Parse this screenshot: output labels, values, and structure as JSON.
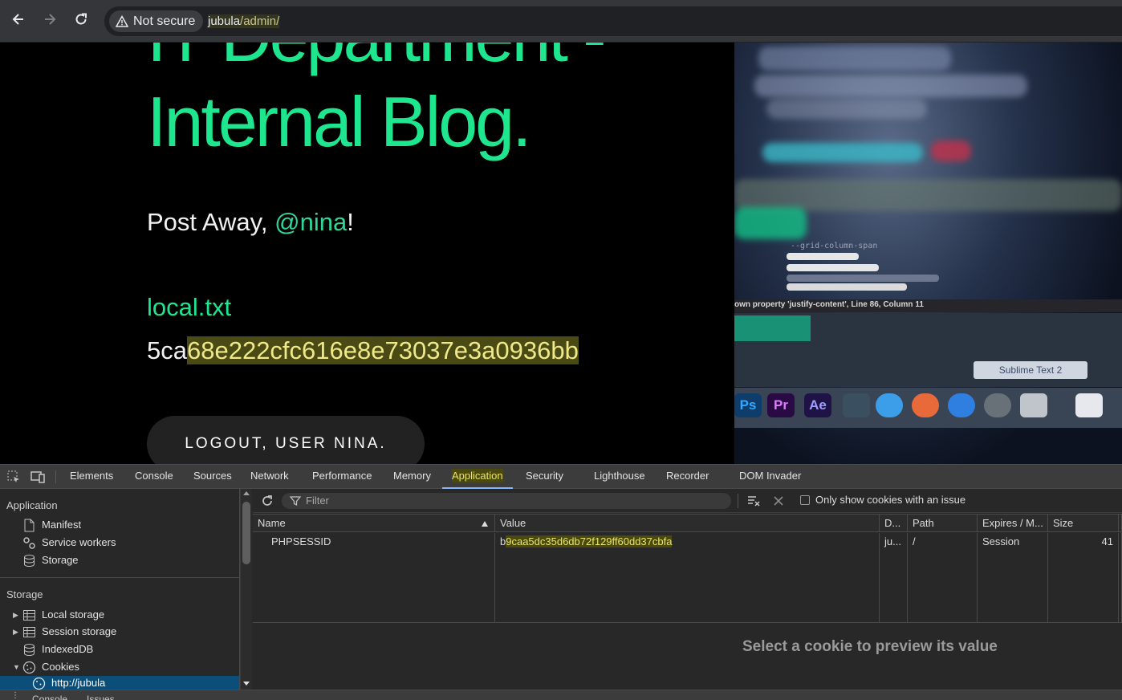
{
  "browser": {
    "security_label": "Not secure",
    "url_host": "jubula",
    "url_path": "/admin/"
  },
  "page": {
    "title_line1": "IT Department -",
    "title_line2": "Internal Blog.",
    "greeting_prefix": "Post Away, ",
    "greeting_user": "@nina",
    "greeting_suffix": "!",
    "file_link": "local.txt",
    "hash_prefix": "5ca",
    "hash_highlight": "68e222cfc616e8e73037e3a0936bb",
    "logout_label": "LOGOUT, USER NINA.",
    "image_text_top": "--grid-column-span",
    "image_caption": "own property 'justify-content', Line 86, Column 11",
    "image_tooltip": "Sublime Text 2",
    "dock_labels": [
      "Ps",
      "Pr",
      "Ae"
    ]
  },
  "devtools": {
    "tabs": [
      "Elements",
      "Console",
      "Sources",
      "Network",
      "Performance",
      "Memory",
      "Application",
      "Security",
      "Lighthouse",
      "Recorder",
      "DOM Invader"
    ],
    "active_tab": "Application",
    "sidebar": {
      "section_application": "Application",
      "app_items": [
        "Manifest",
        "Service workers",
        "Storage"
      ],
      "section_storage": "Storage",
      "storage_items": [
        "Local storage",
        "Session storage",
        "IndexedDB",
        "Cookies"
      ],
      "cookie_origin": "http://jubula"
    },
    "toolbar": {
      "filter_placeholder": "Filter",
      "only_issue_label": "Only show cookies with an issue"
    },
    "table": {
      "headers": [
        "Name",
        "Value",
        "D...",
        "Path",
        "Expires / M...",
        "Size"
      ],
      "row": {
        "name": "PHPSESSID",
        "value_prefix": "b",
        "value_highlight": "9caa5dc35d6db72f129ff60dd37cbfa",
        "domain": "ju...",
        "path": "/",
        "expires": "Session",
        "size": "41"
      }
    },
    "preview_message": "Select a cookie to preview its value",
    "bottom_tabs": [
      "Console",
      "Issues"
    ]
  },
  "colors": {
    "accent_green": "#1de68f",
    "devtools_blue": "#8ab4f8",
    "highlight_yellow": "#e9e36a"
  }
}
